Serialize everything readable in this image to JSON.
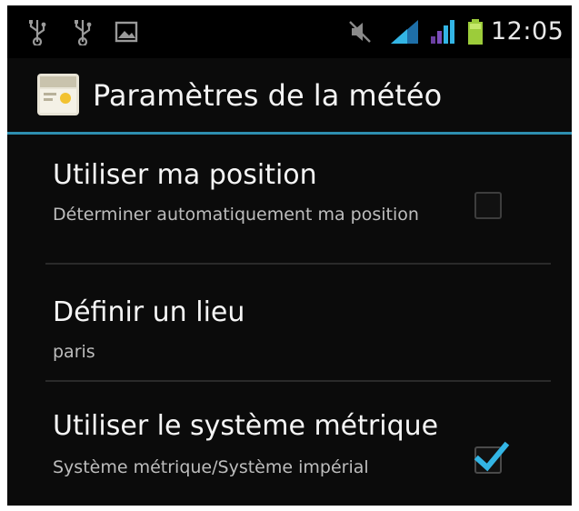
{
  "status_bar": {
    "time": "12:05",
    "icons": [
      "usb-icon",
      "usb-icon",
      "gallery-icon",
      "mute-icon",
      "signal-icon",
      "signal-icon",
      "battery-icon"
    ]
  },
  "action_bar": {
    "title": "Paramètres de la météo",
    "icon": "weather-app-icon"
  },
  "preferences": [
    {
      "title": "Utiliser ma position",
      "summary": "Déterminer automatiquement ma position",
      "checked": false
    },
    {
      "title": "Définir un lieu",
      "summary": "paris"
    },
    {
      "title": "Utiliser le système métrique",
      "summary": "Système métrique/Système impérial",
      "checked": true
    }
  ],
  "colors": {
    "accent": "#2e8fb0",
    "check": "#33b5e5",
    "background": "#0b0b0b"
  }
}
